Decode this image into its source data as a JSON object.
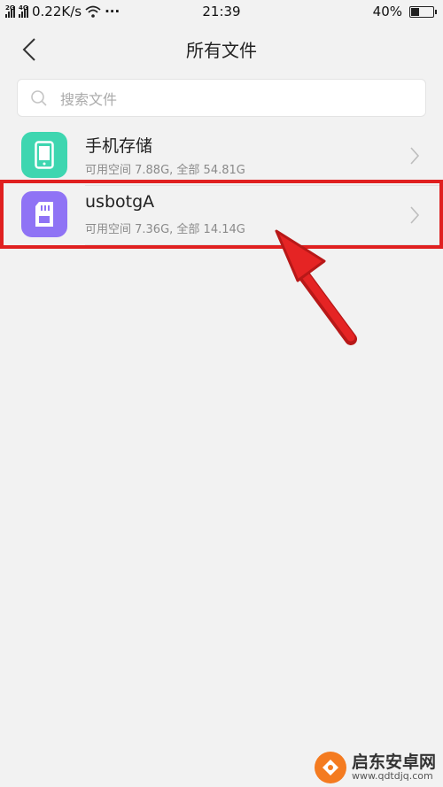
{
  "status_bar": {
    "signal1": "2G",
    "signal2": "4G",
    "speed": "0.22K/s",
    "more": "···",
    "time": "21:39",
    "battery_text": "40%",
    "battery_level": 0.4
  },
  "header": {
    "title": "所有文件"
  },
  "search": {
    "placeholder": "搜索文件"
  },
  "storage_items": [
    {
      "title": "手机存储",
      "subtitle": "可用空间 7.88G, 全部 54.81G",
      "icon": "phone-icon",
      "color": "#3ed6b0"
    },
    {
      "title": "usbotgA",
      "subtitle": "可用空间 7.36G, 全部 14.14G",
      "icon": "sd-card-icon",
      "color": "#8f73f5"
    }
  ],
  "annotation_color": "#e02020",
  "watermark": {
    "name": "启东安卓网",
    "url": "www.qdtdjq.com"
  }
}
